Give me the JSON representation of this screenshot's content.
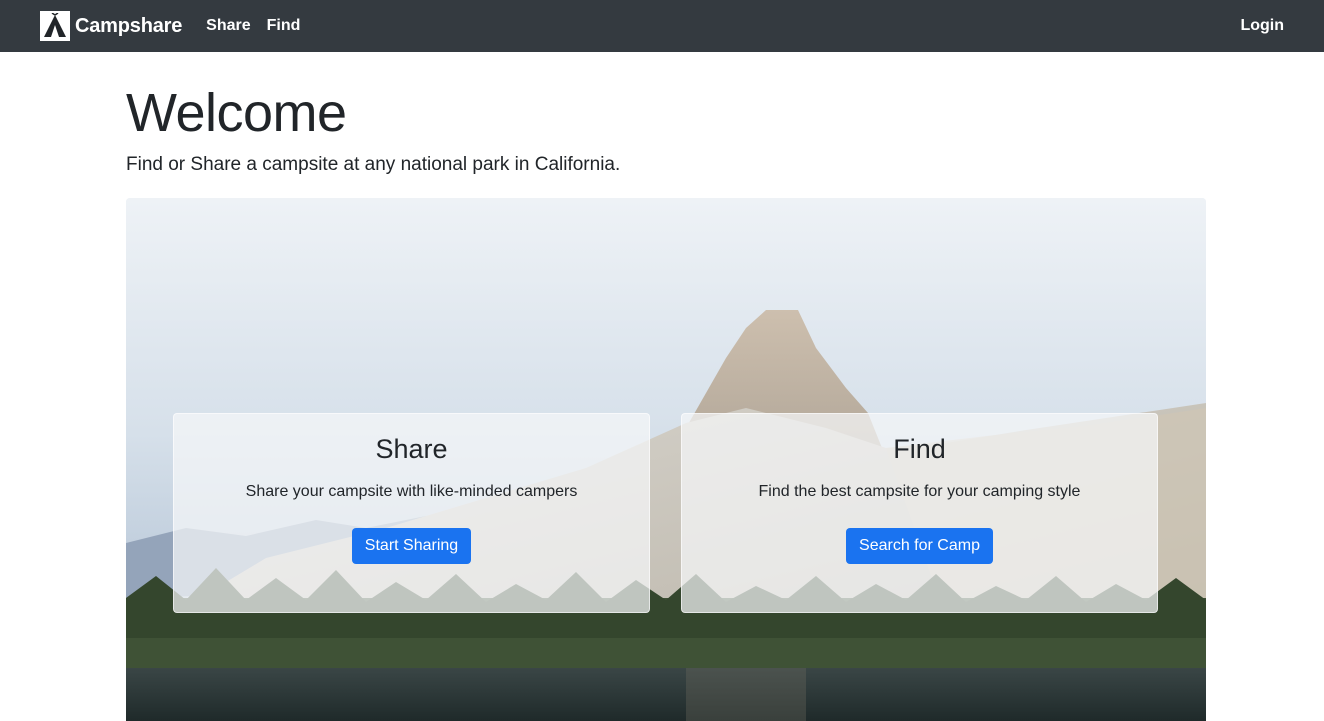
{
  "navbar": {
    "brand": "Campshare",
    "brand_icon": "tent-icon",
    "links": [
      "Share",
      "Find"
    ],
    "login": "Login",
    "background": "#343a40"
  },
  "main": {
    "title": "Welcome",
    "lead": "Find or Share a campsite at any national park in California."
  },
  "hero": {
    "image": "mountain-lake-landscape",
    "cards": [
      {
        "title": "Share",
        "text": "Share your campsite with like-minded campers",
        "button": "Start Sharing"
      },
      {
        "title": "Find",
        "text": "Find the best campsite for your camping style",
        "button": "Search for Camp"
      }
    ]
  },
  "colors": {
    "primary_button": "#1a73f0",
    "navbar": "#343a40"
  }
}
